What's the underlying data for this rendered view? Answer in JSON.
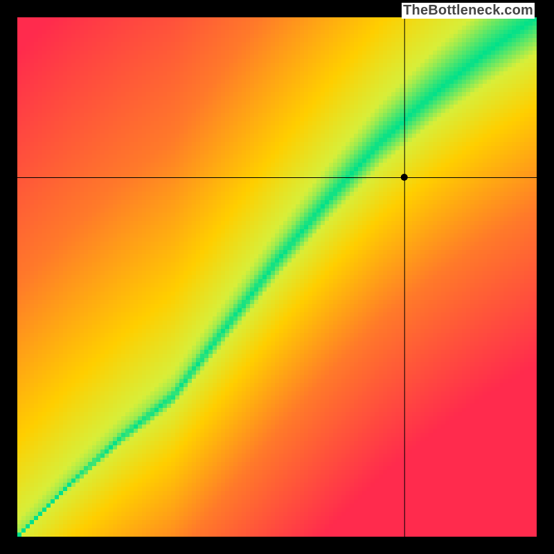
{
  "watermark": "TheBottleneck.com",
  "chart_data": {
    "type": "heatmap",
    "title": "",
    "xlabel": "",
    "ylabel": "",
    "xlim": [
      0,
      1
    ],
    "ylim": [
      0,
      1
    ],
    "crosshair": {
      "x": 0.745,
      "y": 0.692
    },
    "marker": {
      "x": 0.745,
      "y": 0.692
    },
    "ridge": {
      "comment": "green optimal band center y as function of x (image-space, y=0 top). Band narrows toward bottom-left.",
      "points_x": [
        0.0,
        0.1,
        0.2,
        0.3,
        0.4,
        0.5,
        0.6,
        0.7,
        0.8,
        0.9,
        1.0
      ],
      "center_y": [
        1.0,
        0.9,
        0.81,
        0.73,
        0.6,
        0.47,
        0.35,
        0.24,
        0.15,
        0.07,
        0.0
      ],
      "half_width": [
        0.005,
        0.01,
        0.015,
        0.02,
        0.028,
        0.035,
        0.042,
        0.05,
        0.058,
        0.066,
        0.075
      ]
    },
    "color_stops": {
      "comment": "distance-normalized → color",
      "d": [
        0.0,
        0.1,
        0.25,
        0.55,
        1.0
      ],
      "color": [
        "#00e18b",
        "#d8ef3a",
        "#ffcf00",
        "#ff7a2a",
        "#ff2b4d"
      ]
    }
  }
}
